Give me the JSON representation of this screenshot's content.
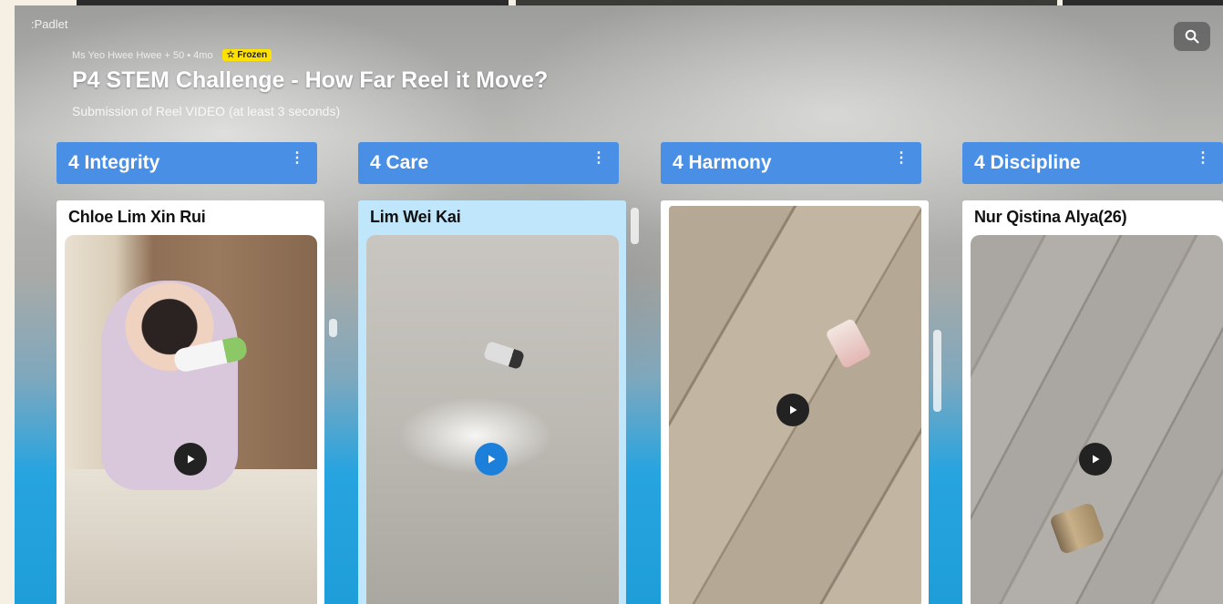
{
  "app": {
    "brand": ":Padlet"
  },
  "board": {
    "author_line": "Ms Yeo Hwee Hwee + 50 • 4mo",
    "frozen_badge": "☆ Frozen",
    "title": "P4 STEM Challenge - How Far Reel it Move?",
    "subtitle": "Submission of Reel VIDEO (at least 3 seconds)"
  },
  "columns": [
    {
      "label": "4 Integrity",
      "menu": "⋮",
      "post_author": "Chloe Lim Xin Rui"
    },
    {
      "label": "4 Care",
      "menu": "⋮",
      "post_author": "Lim Wei Kai"
    },
    {
      "label": "4 Harmony",
      "menu": "⋮",
      "post_author": ""
    },
    {
      "label": "4 Discipline",
      "menu": "⋮",
      "post_author": "Nur Qistina Alya(26)"
    }
  ],
  "icons": {
    "search": "search-icon",
    "play": "play-icon",
    "menu": "more-vertical-icon"
  },
  "colors": {
    "header_blue": "#4a8fe6",
    "frozen_yellow": "#ffe100",
    "selected_card": "#bfe6fb",
    "play_blue": "#1c7fd9"
  }
}
